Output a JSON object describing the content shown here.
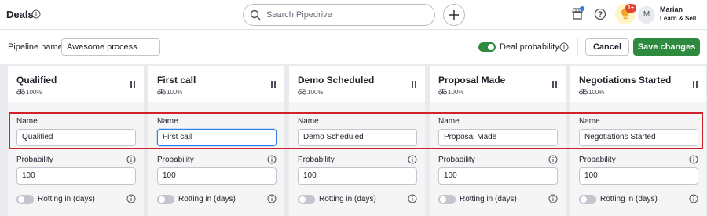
{
  "header": {
    "title": "Deals",
    "search_placeholder": "Search Pipedrive",
    "notification_badge": "1+",
    "avatar_initial": "M",
    "user_name": "Marian",
    "user_company": "Learn & Sell"
  },
  "pipeline": {
    "name_label": "Pipeline name",
    "name_value": "Awesome process",
    "deal_probability_label": "Deal probability",
    "deal_probability_enabled": true,
    "cancel_label": "Cancel",
    "save_label": "Save changes"
  },
  "colors": {
    "primary_green": "#2e8a3f",
    "focus_blue": "#317ae2",
    "highlight_red": "#d3202a"
  },
  "stages": [
    {
      "title": "Qualified",
      "probability_badge": "100%",
      "name_label": "Name",
      "name_value": "Qualified",
      "probability_label": "Probability",
      "probability_value": "100",
      "rotting_label": "Rotting in (days)"
    },
    {
      "title": "First call",
      "probability_badge": "100%",
      "name_label": "Name",
      "name_value": "First call",
      "probability_label": "Probability",
      "probability_value": "100",
      "rotting_label": "Rotting in (days)"
    },
    {
      "title": "Demo Scheduled",
      "probability_badge": "100%",
      "name_label": "Name",
      "name_value": "Demo Scheduled",
      "probability_label": "Probability",
      "probability_value": "100",
      "rotting_label": "Rotting in (days)"
    },
    {
      "title": "Proposal Made",
      "probability_badge": "100%",
      "name_label": "Name",
      "name_value": "Proposal Made",
      "probability_label": "Probability",
      "probability_value": "100",
      "rotting_label": "Rotting in (days)"
    },
    {
      "title": "Negotiations Started",
      "probability_badge": "100%",
      "name_label": "Name",
      "name_value": "Negotiations Started",
      "probability_label": "Probability",
      "probability_value": "100",
      "rotting_label": "Rotting in (days)"
    }
  ]
}
